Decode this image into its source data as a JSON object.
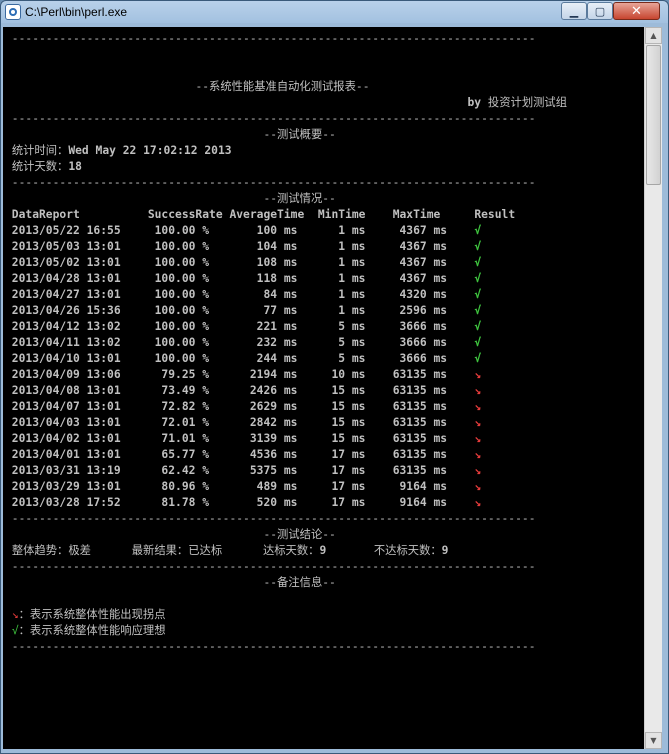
{
  "window": {
    "title": "C:\\Perl\\bin\\perl.exe",
    "min_glyph": "▁",
    "max_glyph": "▢",
    "close_glyph": "✕"
  },
  "scrollbar": {
    "up_glyph": "▲",
    "down_glyph": "▼"
  },
  "report": {
    "rule": "-----------------------------------------------------------------------------",
    "title": "--系统性能基准自动化测试报表--",
    "byline_prefix": "by",
    "byline_team": "投资计划测试组",
    "overview_header": "--测试概要--",
    "stat_time_label": "统计时间：",
    "stat_time_value": "Wed May 22 17:02:12 2013",
    "stat_days_label": "统计天数：",
    "stat_days_value": "18",
    "status_header": "--测试情况--",
    "columns": [
      "DataReport",
      "SuccessRate",
      "AverageTime",
      "MinTime",
      "MaxTime",
      "Result"
    ],
    "rows": [
      {
        "date": "2013/05/22 16:55",
        "rate": "100.00 %",
        "avg": "100 ms",
        "min": "1 ms",
        "max": "4367 ms",
        "result": "ok"
      },
      {
        "date": "2013/05/03 13:01",
        "rate": "100.00 %",
        "avg": "104 ms",
        "min": "1 ms",
        "max": "4367 ms",
        "result": "ok"
      },
      {
        "date": "2013/05/02 13:01",
        "rate": "100.00 %",
        "avg": "108 ms",
        "min": "1 ms",
        "max": "4367 ms",
        "result": "ok"
      },
      {
        "date": "2013/04/28 13:01",
        "rate": "100.00 %",
        "avg": "118 ms",
        "min": "1 ms",
        "max": "4367 ms",
        "result": "ok"
      },
      {
        "date": "2013/04/27 13:01",
        "rate": "100.00 %",
        "avg": "84 ms",
        "min": "1 ms",
        "max": "4320 ms",
        "result": "ok"
      },
      {
        "date": "2013/04/26 15:36",
        "rate": "100.00 %",
        "avg": "77 ms",
        "min": "1 ms",
        "max": "2596 ms",
        "result": "ok"
      },
      {
        "date": "2013/04/12 13:02",
        "rate": "100.00 %",
        "avg": "221 ms",
        "min": "5 ms",
        "max": "3666 ms",
        "result": "ok"
      },
      {
        "date": "2013/04/11 13:02",
        "rate": "100.00 %",
        "avg": "232 ms",
        "min": "5 ms",
        "max": "3666 ms",
        "result": "ok"
      },
      {
        "date": "2013/04/10 13:01",
        "rate": "100.00 %",
        "avg": "244 ms",
        "min": "5 ms",
        "max": "3666 ms",
        "result": "ok"
      },
      {
        "date": "2013/04/09 13:06",
        "rate": "79.25 %",
        "avg": "2194 ms",
        "min": "10 ms",
        "max": "63135 ms",
        "result": "bad"
      },
      {
        "date": "2013/04/08 13:01",
        "rate": "73.49 %",
        "avg": "2426 ms",
        "min": "15 ms",
        "max": "63135 ms",
        "result": "bad"
      },
      {
        "date": "2013/04/07 13:01",
        "rate": "72.82 %",
        "avg": "2629 ms",
        "min": "15 ms",
        "max": "63135 ms",
        "result": "bad"
      },
      {
        "date": "2013/04/03 13:01",
        "rate": "72.01 %",
        "avg": "2842 ms",
        "min": "15 ms",
        "max": "63135 ms",
        "result": "bad"
      },
      {
        "date": "2013/04/02 13:01",
        "rate": "71.01 %",
        "avg": "3139 ms",
        "min": "15 ms",
        "max": "63135 ms",
        "result": "bad"
      },
      {
        "date": "2013/04/01 13:01",
        "rate": "65.77 %",
        "avg": "4536 ms",
        "min": "17 ms",
        "max": "63135 ms",
        "result": "bad"
      },
      {
        "date": "2013/03/31 13:19",
        "rate": "62.42 %",
        "avg": "5375 ms",
        "min": "17 ms",
        "max": "63135 ms",
        "result": "bad"
      },
      {
        "date": "2013/03/29 13:01",
        "rate": "80.96 %",
        "avg": "489 ms",
        "min": "17 ms",
        "max": "9164 ms",
        "result": "bad"
      },
      {
        "date": "2013/03/28 17:52",
        "rate": "81.78 %",
        "avg": "520 ms",
        "min": "17 ms",
        "max": "9164 ms",
        "result": "bad"
      }
    ],
    "ok_glyph": "√",
    "bad_glyph": "↘",
    "conclusion_header": "--测试结论--",
    "trend_label": "整体趋势：",
    "trend_value": "极差",
    "latest_label": "最新结果：",
    "latest_value": "已达标",
    "pass_days_label": "达标天数：",
    "pass_days_value": "9",
    "fail_days_label": "不达标天数：",
    "fail_days_value": "9",
    "notes_header": "--备注信息--",
    "notes": [
      {
        "glyph": "↘",
        "text": "：表示系统整体性能出现拐点"
      },
      {
        "glyph": "√",
        "text": "：表示系统整体性能响应理想"
      }
    ]
  }
}
